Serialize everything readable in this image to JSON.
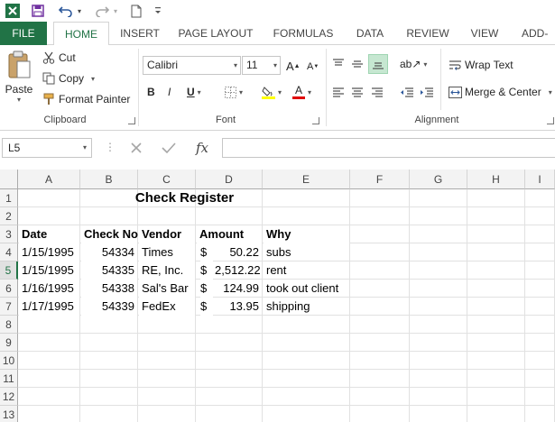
{
  "ribbon_tabs": [
    "FILE",
    "HOME",
    "INSERT",
    "PAGE LAYOUT",
    "FORMULAS",
    "DATA",
    "REVIEW",
    "VIEW",
    "ADD-IN"
  ],
  "clipboard": {
    "paste": "Paste",
    "cut": "Cut",
    "copy": "Copy",
    "format_painter": "Format Painter",
    "group": "Clipboard"
  },
  "font": {
    "name": "Calibri",
    "size": "11",
    "group": "Font"
  },
  "alignment": {
    "wrap_text": "Wrap Text",
    "merge_center": "Merge & Center",
    "group": "Alignment"
  },
  "formula_bar": {
    "name_box": "L5",
    "fx": "fx",
    "formula": ""
  },
  "sheet": {
    "columns": [
      "A",
      "B",
      "C",
      "D",
      "E",
      "F",
      "G",
      "H",
      "I"
    ],
    "rows": [
      "1",
      "2",
      "3",
      "4",
      "5",
      "6",
      "7",
      "8",
      "9",
      "10",
      "11",
      "12",
      "13"
    ],
    "selected_row": "5",
    "title": "Check Register",
    "headers": [
      "Date",
      "Check No",
      "Vendor",
      "Amount",
      "Why"
    ],
    "records": [
      {
        "date": "1/15/1995",
        "check": "54334",
        "vendor": "Times",
        "cur": "$",
        "amount": "50.22",
        "why": "subs"
      },
      {
        "date": "1/15/1995",
        "check": "54335",
        "vendor": "RE, Inc.",
        "cur": "$",
        "amount": "2,512.22",
        "why": "rent"
      },
      {
        "date": "1/16/1995",
        "check": "54338",
        "vendor": "Sal's Bar",
        "cur": "$",
        "amount": "124.99",
        "why": "took out client"
      },
      {
        "date": "1/17/1995",
        "check": "54339",
        "vendor": "FedEx",
        "cur": "$",
        "amount": "13.95",
        "why": "shipping"
      }
    ]
  },
  "colors": {
    "excel_green": "#217346",
    "header_bg": "#f3f3f3",
    "gridline": "#e1e1e1"
  }
}
